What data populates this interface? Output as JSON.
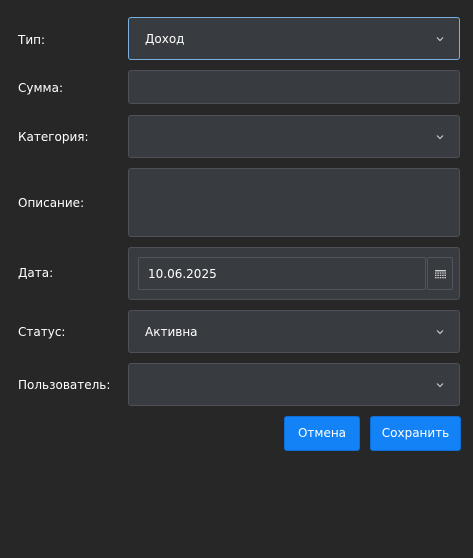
{
  "form": {
    "type": {
      "label": "Тип:",
      "value": "Доход"
    },
    "amount": {
      "label": "Сумма:",
      "value": ""
    },
    "category": {
      "label": "Категория:",
      "value": ""
    },
    "description": {
      "label": "Описание:",
      "value": ""
    },
    "date": {
      "label": "Дата:",
      "value": "10.06.2025"
    },
    "status": {
      "label": "Статус:",
      "value": "Активна"
    },
    "user": {
      "label": "Пользователь:",
      "value": ""
    }
  },
  "buttons": {
    "cancel": "Отмена",
    "save": "Сохранить"
  },
  "icons": {
    "dropdown": "chevron-down-icon",
    "calendar": "calendar-icon"
  },
  "colors": {
    "background": "#272727",
    "field": "#383b40",
    "field_border": "#4d5056",
    "focus_border": "#7ab0e0",
    "accent": "#1282f6"
  }
}
